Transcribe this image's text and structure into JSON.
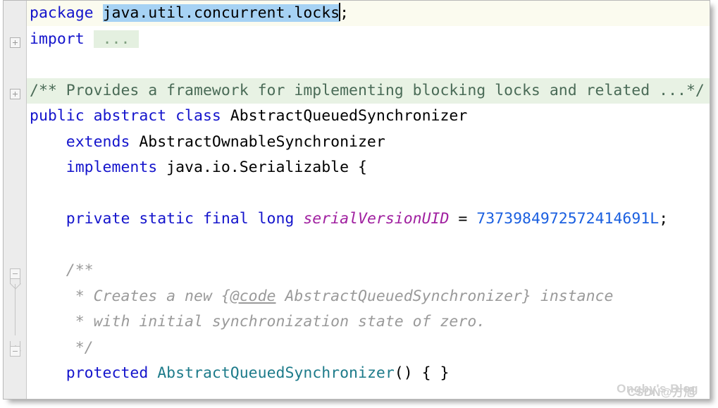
{
  "editor": {
    "language": "java",
    "colors": {
      "keyword": "#1414cc",
      "identifier": "#000000",
      "field": "#a020a0",
      "number": "#1a5fe0",
      "constructor": "#1d7b8a",
      "folded_comment_bg": "#e8f2e4",
      "caret_line_bg": "#fbfbef",
      "selection_bg": "#a6d2f4",
      "javadoc": "#9a9a9a",
      "gutter_bg": "#ececec"
    },
    "lines": [
      {
        "n": 1,
        "fold": "none",
        "bg": "caret-line",
        "segments": [
          {
            "t": "package",
            "cls": "kw"
          },
          {
            "t": " ",
            "cls": "plain"
          },
          {
            "t": "java.util.concurrent.locks",
            "cls": "plain sel"
          },
          {
            "t": "CARET",
            "cls": "caret"
          },
          {
            "t": ";",
            "cls": "plain"
          }
        ]
      },
      {
        "n": 2,
        "fold": "plus",
        "bg": "none",
        "segments": [
          {
            "t": "import",
            "cls": "kw"
          },
          {
            "t": " ",
            "cls": "plain"
          },
          {
            "t": " ... ",
            "cls": "cmt greenbox"
          }
        ]
      },
      {
        "n": 3,
        "fold": "none",
        "bg": "none",
        "segments": []
      },
      {
        "n": 4,
        "fold": "plus",
        "bg": "comment",
        "segments": [
          {
            "t": "/** Provides a framework for implementing blocking locks and related ...*/",
            "cls": "cmtfold"
          }
        ]
      },
      {
        "n": 5,
        "fold": "none",
        "bg": "none",
        "segments": [
          {
            "t": "public abstract class",
            "cls": "kw"
          },
          {
            "t": " AbstractQueuedSynchronizer",
            "cls": "type"
          }
        ]
      },
      {
        "n": 6,
        "fold": "none",
        "bg": "none",
        "segments": [
          {
            "t": "    extends",
            "cls": "kw"
          },
          {
            "t": " AbstractOwnableSynchronizer",
            "cls": "type"
          }
        ]
      },
      {
        "n": 7,
        "fold": "none",
        "bg": "none",
        "segments": [
          {
            "t": "    implements",
            "cls": "kw"
          },
          {
            "t": " java.io.Serializable {",
            "cls": "type"
          }
        ]
      },
      {
        "n": 8,
        "fold": "none",
        "bg": "none",
        "segments": []
      },
      {
        "n": 9,
        "fold": "none",
        "bg": "none",
        "segments": [
          {
            "t": "    private static final long",
            "cls": "kw"
          },
          {
            "t": " ",
            "cls": "plain"
          },
          {
            "t": "serialVersionUID",
            "cls": "field"
          },
          {
            "t": " = ",
            "cls": "plain"
          },
          {
            "t": "7373984972572414691L",
            "cls": "num"
          },
          {
            "t": ";",
            "cls": "plain"
          }
        ]
      },
      {
        "n": 10,
        "fold": "none",
        "bg": "none",
        "segments": []
      },
      {
        "n": 11,
        "fold": "cap-down",
        "bg": "none",
        "segments": [
          {
            "t": "    /**",
            "cls": "jdoc"
          }
        ]
      },
      {
        "n": 12,
        "fold": "stem",
        "bg": "none",
        "segments": [
          {
            "t": "     * Creates a new {",
            "cls": "jdoc"
          },
          {
            "t": "@code",
            "cls": "jdoc link"
          },
          {
            "t": " AbstractQueuedSynchronizer} instance",
            "cls": "jdoc"
          }
        ]
      },
      {
        "n": 13,
        "fold": "stem",
        "bg": "none",
        "segments": [
          {
            "t": "     * with initial synchronization state of zero.",
            "cls": "jdoc"
          }
        ]
      },
      {
        "n": 14,
        "fold": "cap-up",
        "bg": "none",
        "segments": [
          {
            "t": "     */",
            "cls": "jdoc"
          }
        ]
      },
      {
        "n": 15,
        "fold": "none",
        "bg": "none",
        "segments": [
          {
            "t": "    protected",
            "cls": "kw"
          },
          {
            "t": " ",
            "cls": "plain"
          },
          {
            "t": "AbstractQueuedSynchronizer",
            "cls": "ctor"
          },
          {
            "t": "() { }",
            "cls": "plain"
          }
        ]
      }
    ]
  },
  "watermark": {
    "text_1": "Ongby's Blog",
    "text_2": "CSDN@方旭"
  }
}
